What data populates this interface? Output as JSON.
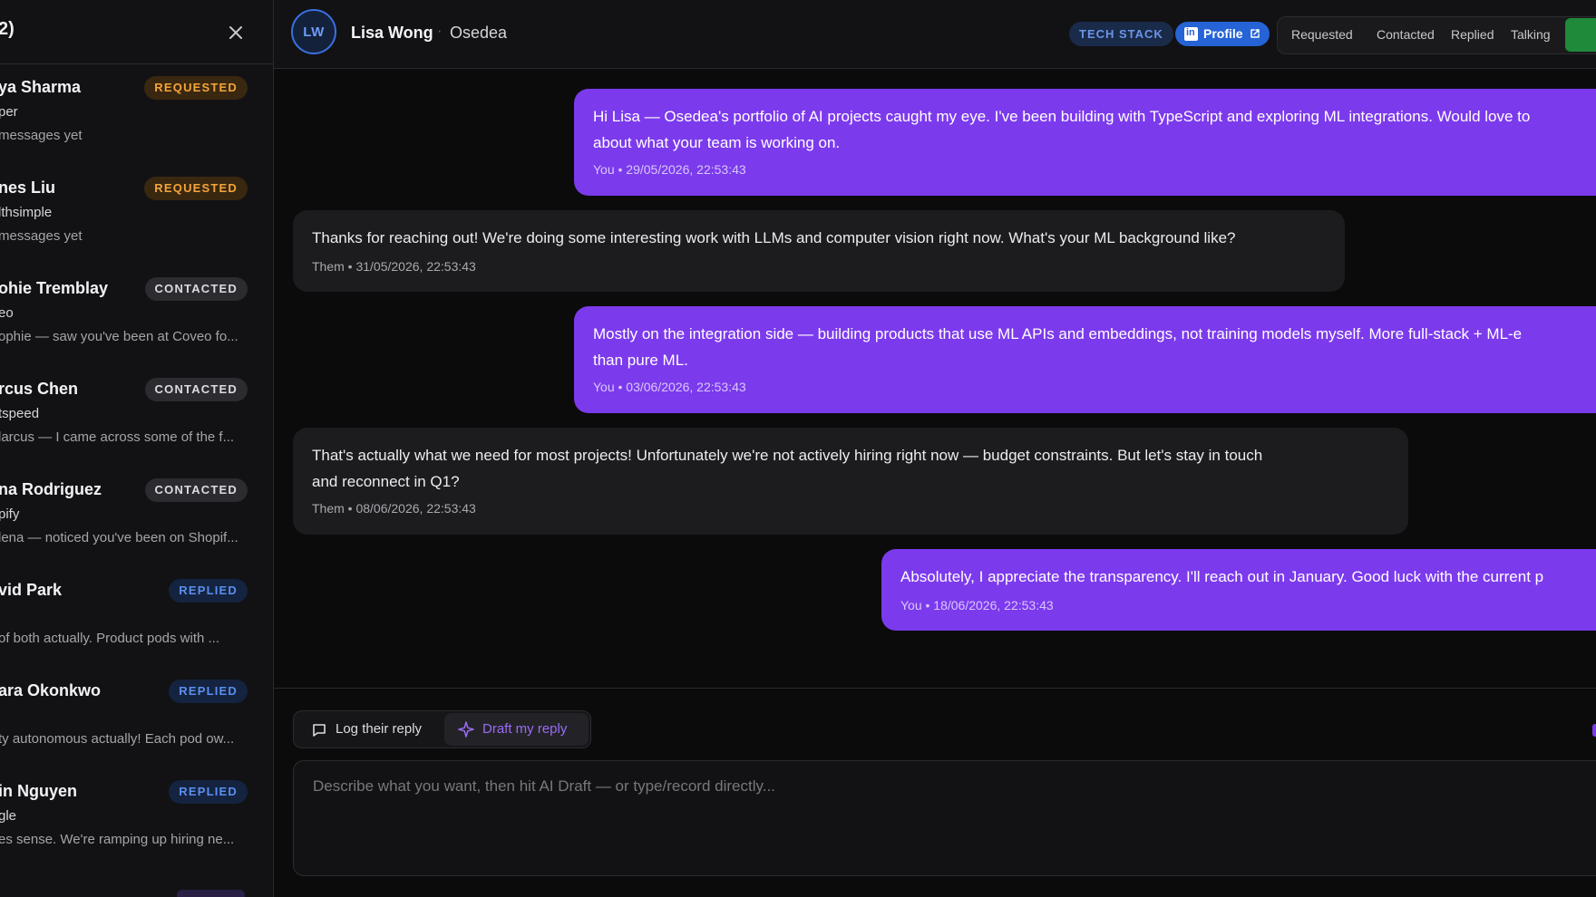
{
  "sidebar": {
    "title": "2)",
    "contacts": [
      {
        "name": "ya Sharma",
        "company": "per",
        "preview": "messages yet",
        "status": "REQUESTED",
        "kind": "requested"
      },
      {
        "name": "nes Liu",
        "company": "lthsimple",
        "preview": "messages yet",
        "status": "REQUESTED",
        "kind": "requested"
      },
      {
        "name": "ohie Tremblay",
        "company": "eo",
        "preview": "ophie — saw you've been at Coveo fo...",
        "status": "CONTACTED",
        "kind": "contacted"
      },
      {
        "name": "rcus Chen",
        "company": "tspeed",
        "preview": "larcus — I came across some of the f...",
        "status": "CONTACTED",
        "kind": "contacted"
      },
      {
        "name": "na Rodriguez",
        "company": "pify",
        "preview": "lena — noticed you've been on Shopif...",
        "status": "CONTACTED",
        "kind": "contacted"
      },
      {
        "name": "vid Park",
        "company": "",
        "preview": "of both actually. Product pods with ...",
        "status": "REPLIED",
        "kind": "replied"
      },
      {
        "name": "ara Okonkwo",
        "company": "",
        "preview": "ty autonomous actually! Each pod ow...",
        "status": "REPLIED",
        "kind": "replied"
      },
      {
        "name": "in Nguyen",
        "company": "gle",
        "preview": "es sense. We're ramping up hiring ne...",
        "status": "REPLIED",
        "kind": "replied"
      }
    ]
  },
  "header": {
    "avatar_initials": "LW",
    "name": "Lisa Wong",
    "separator": "·",
    "company": "Osedea",
    "tech_stack_label": "TECH STACK",
    "profile_label": "Profile",
    "status_tabs": [
      "Requested",
      "Contacted",
      "Replied",
      "Talking"
    ]
  },
  "messages": [
    {
      "from": "you",
      "text": "Hi Lisa — Osedea's portfolio of AI projects caught my eye. I've been building with TypeScript and exploring ML integrations. Would love to",
      "text2": "about what your team is working on.",
      "meta": "You • 29/05/2026, 22:53:43"
    },
    {
      "from": "them",
      "text": "Thanks for reaching out! We're doing some interesting work with LLMs and computer vision right now. What's your ML background like?",
      "meta": "Them • 31/05/2026, 22:53:43"
    },
    {
      "from": "you",
      "text": "Mostly on the integration side — building products that use ML APIs and embeddings, not training models myself. More full-stack + ML-e",
      "text2": "than pure ML.",
      "meta": "You • 03/06/2026, 22:53:43"
    },
    {
      "from": "them",
      "text": "That's actually what we need for most projects! Unfortunately we're not actively hiring right now — budget constraints. But let's stay in touch",
      "text2": "and reconnect in Q1?",
      "meta": "Them • 08/06/2026, 22:53:43"
    },
    {
      "from": "you",
      "text": "Absolutely, I appreciate the transparency. I'll reach out in January. Good luck with the current p",
      "meta": "You • 18/06/2026, 22:53:43"
    }
  ],
  "composer": {
    "log_label": "Log their reply",
    "draft_label": "Draft my reply",
    "placeholder": "Describe what you want, then hit AI Draft — or type/record directly..."
  },
  "colors": {
    "accent_purple": "#7c3aed",
    "requested": "#f3a53a",
    "replied": "#5a8ff0",
    "linkedin": "#2563d6"
  }
}
